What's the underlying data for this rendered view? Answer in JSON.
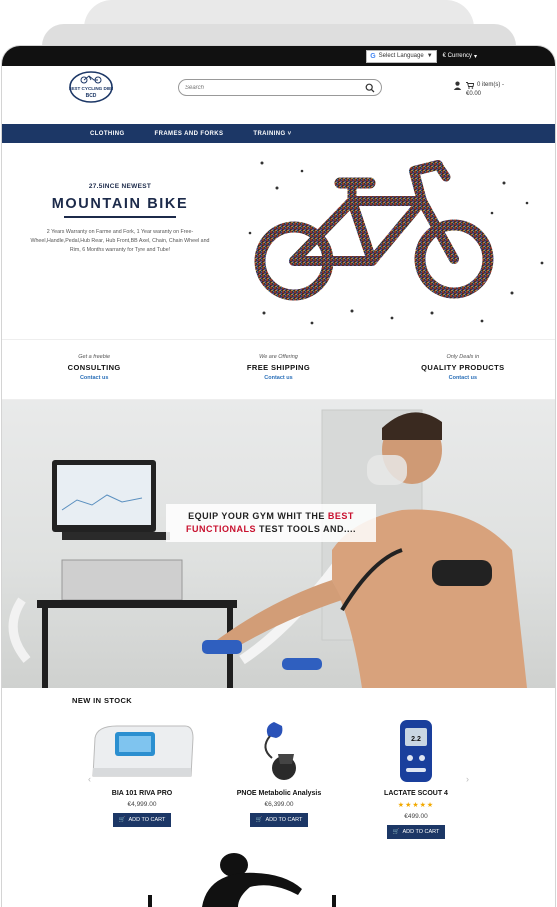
{
  "topbar": {
    "language_label": "Select Language",
    "currency_label": "€ Currency",
    "currency_caret": "▾",
    "lang_caret": "▼"
  },
  "header": {
    "logo_text": "BEST CYCLING DIET",
    "search_placeholder": "Search",
    "cart_label": "0 item(s) -",
    "cart_total": "€0.00"
  },
  "nav": {
    "items": [
      "CLOTHING",
      "FRAMES AND FORKS",
      "TRAINING ˅"
    ]
  },
  "hero": {
    "kicker": "27.5INCE NEWEST",
    "title": "MOUNTAIN BIKE",
    "description": "2 Years Warranty on Farme and Fork, 1 Year waranty on Free-Wheel,Handle,Pedal,Hub Rear, Hub Front,BB Axel, Chain, Chain Wheel and Rim, 6 Months warranty for Tyre and Tube!"
  },
  "features": [
    {
      "kicker": "Get a freebie",
      "title": "CONSULTING",
      "link": "Contact us"
    },
    {
      "kicker": "We are Offering",
      "title": "FREE SHIPPING",
      "link": "Contact us"
    },
    {
      "kicker": "Only Deals in",
      "title": "QUALITY PRODUCTS",
      "link": "Contact us"
    }
  ],
  "banner": {
    "line1_a": "EQUIP YOUR GYM WHIT THE ",
    "line1_b": "BEST",
    "line2_a": "FUNCTIONALS",
    "line2_b": " TEST TOOLS AND...."
  },
  "stock": {
    "title": "NEW IN STOCK",
    "products": [
      {
        "name": "BIA 101 RIVA PRO",
        "price": "€4,999.00",
        "button": "ADD TO CART",
        "stars": ""
      },
      {
        "name": "PNOE Metabolic Analysis",
        "price": "€6,399.00",
        "button": "ADD TO CART",
        "stars": ""
      },
      {
        "name": "LACTATE SCOUT 4",
        "price": "€499.00",
        "button": "ADD TO CART",
        "stars": "★★★★★"
      }
    ],
    "prev_arrow": "‹",
    "next_arrow": "›"
  },
  "colors": {
    "nav_bg": "#1c3766",
    "accent_red": "#c8102e",
    "link_blue": "#2a6fb8",
    "star": "#f2a900"
  },
  "icons": [
    "google-translate-icon",
    "search-icon",
    "user-icon",
    "cart-icon",
    "logo-bike-icon"
  ]
}
